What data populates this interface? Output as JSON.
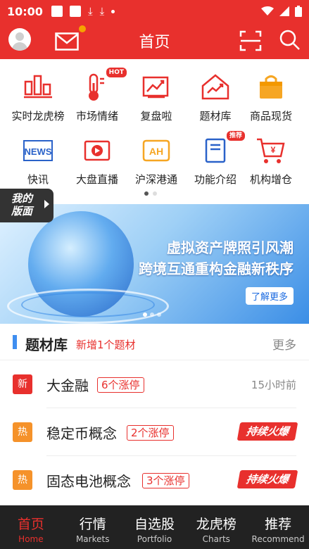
{
  "status_bar": {
    "time": "10:00"
  },
  "header": {
    "title": "首页"
  },
  "quick_menu": [
    {
      "label": "实时龙虎榜",
      "icon": "bar-chart-icon"
    },
    {
      "label": "市场情绪",
      "icon": "thermometer-icon",
      "badge": "HOT"
    },
    {
      "label": "复盘啦",
      "icon": "review-chart-icon"
    },
    {
      "label": "题材库",
      "icon": "trend-house-icon"
    },
    {
      "label": "商品现货",
      "icon": "bag-icon"
    },
    {
      "label": "快讯",
      "icon": "news-icon",
      "icon_text": "NEWS"
    },
    {
      "label": "大盘直播",
      "icon": "play-icon"
    },
    {
      "label": "沪深港通",
      "icon": "ah-icon",
      "icon_text": "AH"
    },
    {
      "label": "功能介绍",
      "icon": "book-icon",
      "badge": "推荐"
    },
    {
      "label": "机构增仓",
      "icon": "cart-icon",
      "icon_text": "¥"
    }
  ],
  "my_version": {
    "line1": "我的",
    "line2": "版面"
  },
  "banner": {
    "line1": "虚拟资产牌照引风潮",
    "line2": "跨境互通重构金融新秩序",
    "button": "了解更多"
  },
  "topics": {
    "title": "题材库",
    "subtitle": "新增1个题材",
    "more": "更多",
    "items": [
      {
        "tag": "新",
        "tag_color": "#e8302d",
        "name": "大金融",
        "limit": "6个涨停",
        "time": "15小时前"
      },
      {
        "tag": "热",
        "tag_color": "#f5922a",
        "name": "稳定币概念",
        "limit": "2个涨停",
        "hot": "持续火爆"
      },
      {
        "tag": "热",
        "tag_color": "#f5922a",
        "name": "固态电池概念",
        "limit": "3个涨停",
        "hot": "持续火爆"
      }
    ]
  },
  "tabs": [
    {
      "zh": "首页",
      "en": "Home",
      "active": true
    },
    {
      "zh": "行情",
      "en": "Markets"
    },
    {
      "zh": "自选股",
      "en": "Portfolio"
    },
    {
      "zh": "龙虎榜",
      "en": "Charts"
    },
    {
      "zh": "推荐",
      "en": "Recommend"
    }
  ],
  "colors": {
    "brand": "#e8302d",
    "dark": "#222222",
    "accent_blue": "#3f8ef0"
  }
}
